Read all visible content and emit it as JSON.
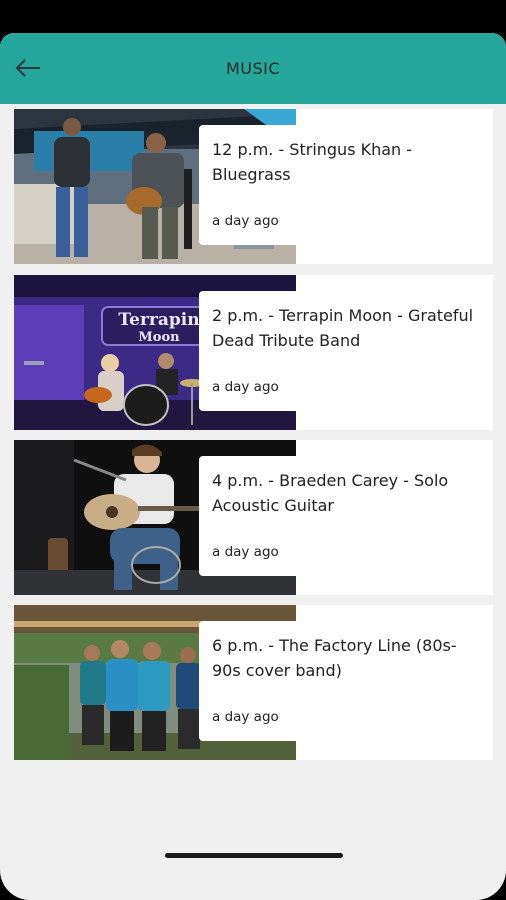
{
  "header": {
    "title": "MUSIC",
    "back_icon": "arrow-left-icon",
    "color": "#27a79b"
  },
  "items": [
    {
      "title": "12 p.m. - Stringus Khan - Bluegrass",
      "time": "a day ago"
    },
    {
      "title": "2 p.m. - Terrapin Moon - Grateful Dead Tribute Band",
      "time": "a day ago",
      "image_text": "Terrapin Moon"
    },
    {
      "title": "4 p.m. - Braeden Carey - Solo Acoustic Guitar",
      "time": "a day ago"
    },
    {
      "title": "6 p.m. - The Factory Line (80s-90s cover band)",
      "time": "a day ago"
    }
  ]
}
